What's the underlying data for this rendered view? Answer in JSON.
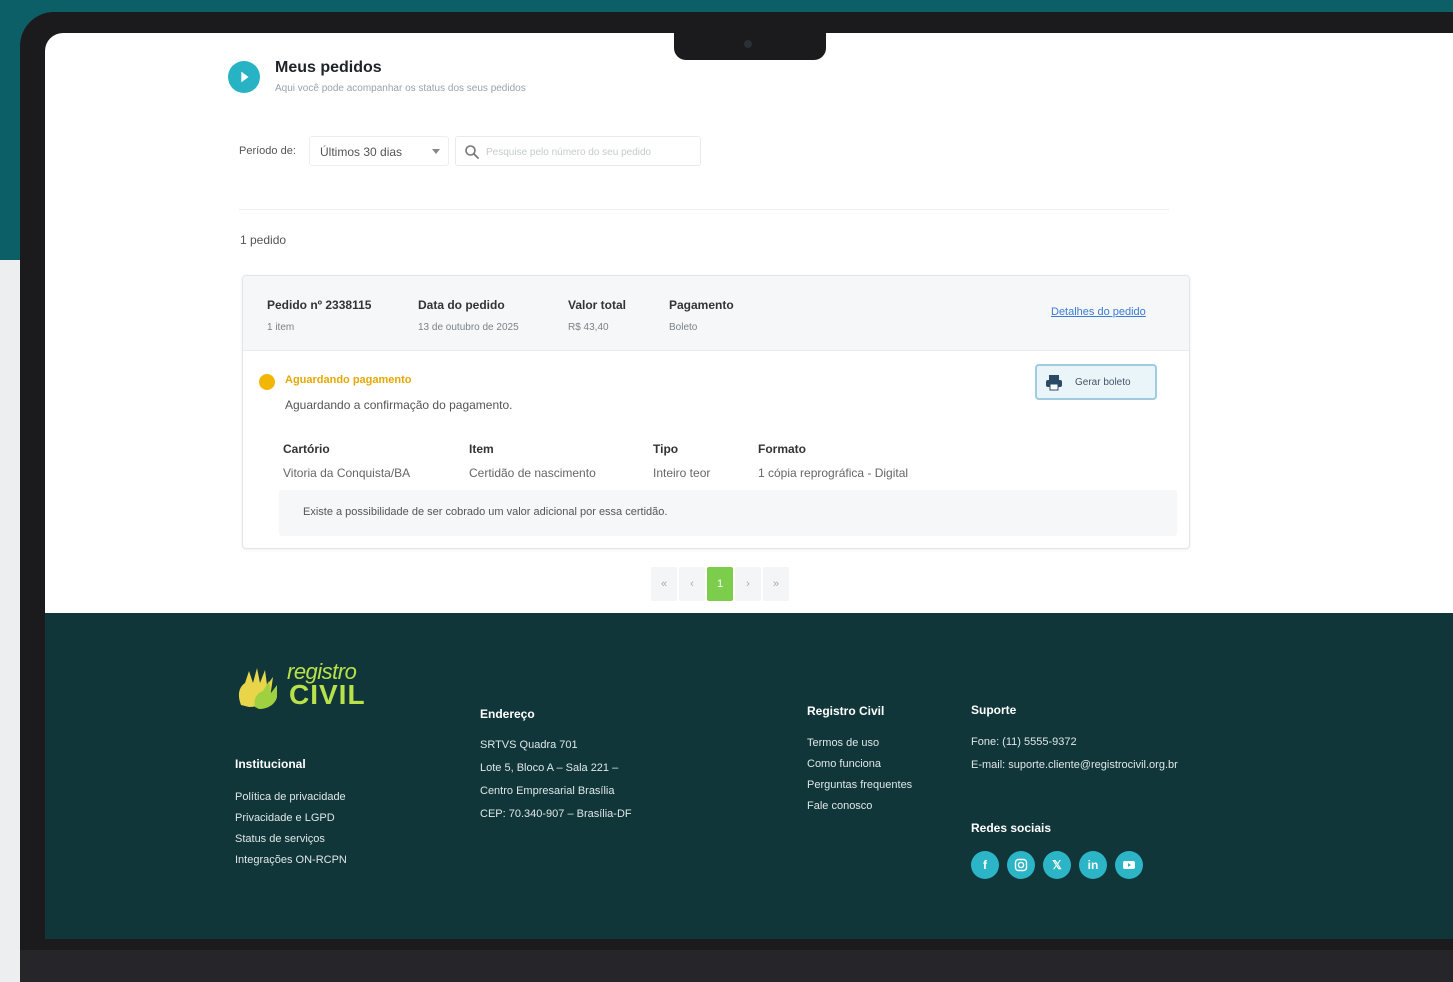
{
  "header": {
    "title": "Meus pedidos",
    "subtitle": "Aqui você pode acompanhar os status dos seus pedidos"
  },
  "filters": {
    "period_label": "Período de:",
    "period_value": "Últimos 30 dias",
    "search_placeholder": "Pesquise pelo número do seu pedido"
  },
  "results": {
    "count_text": "1 pedido"
  },
  "order": {
    "number_label": "Pedido nº 2338115",
    "items": "1 item",
    "date_label": "Data do pedido",
    "date_value": "13 de outubro de 2025",
    "total_label": "Valor total",
    "total_value": "R$ 43,40",
    "payment_label": "Pagamento",
    "payment_value": "Boleto",
    "details_link": "Detalhes do pedido",
    "status": "Aguardando pagamento",
    "status_desc": "Aguardando a confirmação do pagamento.",
    "boleto_button": "Gerar boleto",
    "details": {
      "office_label": "Cartório",
      "office_value": "Vitoria da Conquista/BA",
      "item_label": "Item",
      "item_value": "Certidão de nascimento",
      "type_label": "Tipo",
      "type_value": "Inteiro teor",
      "format_label": "Formato",
      "format_value": "1 cópia reprográfica - Digital"
    },
    "note": "Existe a possibilidade de ser cobrado um valor adicional por essa certidão."
  },
  "pagination": {
    "first": "«",
    "prev": "‹",
    "current": "1",
    "next": "›",
    "last": "»"
  },
  "footer": {
    "logo": {
      "line1": "registro",
      "line2": "CIVIL"
    },
    "institutional": {
      "heading": "Institucional",
      "links": [
        "Política de privacidade",
        "Privacidade e LGPD",
        "Status de serviços",
        "Integrações ON-RCPN"
      ]
    },
    "address": {
      "heading": "Endereço",
      "lines": [
        "SRTVS Quadra 701",
        "Lote 5, Bloco A – Sala 221 –",
        "Centro Empresarial Brasília",
        "CEP: 70.340-907 – Brasília-DF"
      ]
    },
    "registro_civil": {
      "heading": "Registro Civil",
      "links": [
        "Termos de uso",
        "Como funciona",
        "Perguntas frequentes",
        "Fale conosco"
      ]
    },
    "support": {
      "heading": "Suporte",
      "phone": "Fone: (11) 5555-9372",
      "email": "E-mail: suporte.cliente@registrocivil.org.br"
    },
    "social": {
      "heading": "Redes sociais",
      "icons": [
        "facebook-icon",
        "instagram-icon",
        "x-icon",
        "linkedin-icon",
        "youtube-icon"
      ]
    }
  },
  "colors": {
    "accent": "#27b3c4",
    "status_pending": "#f2b705",
    "pagination_active": "#7ccd4b",
    "footer_bg": "#103639",
    "logo": "#b9e14a"
  }
}
